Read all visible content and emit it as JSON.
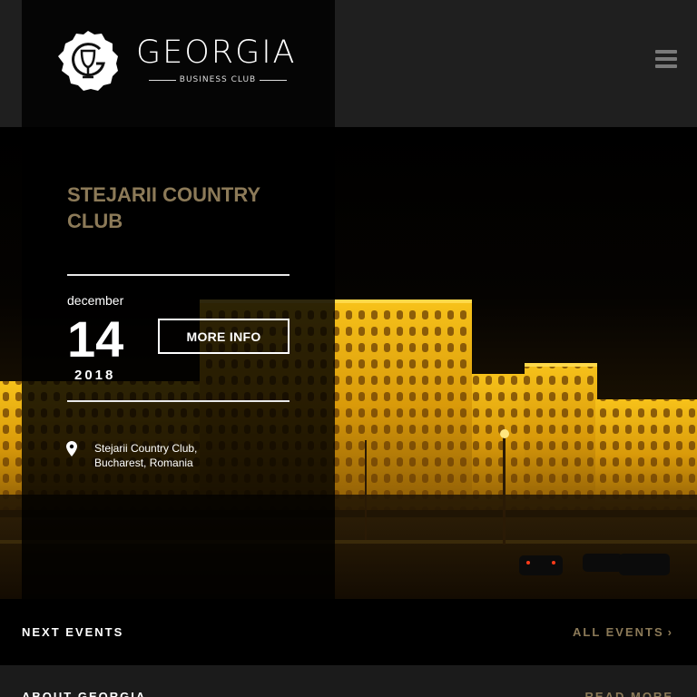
{
  "brand": {
    "name": "GEORGIA",
    "subtitle": "BUSINESS CLUB",
    "logo_icon": "wine-glass-g-logo-icon"
  },
  "header": {
    "menu_icon": "hamburger-menu-icon"
  },
  "featured_event": {
    "title": "STEJARII COUNTRY CLUB",
    "month": "december",
    "day": "14",
    "year": "2018",
    "more_info_label": "MORE INFO",
    "location_icon": "map-pin-icon",
    "address_line1": "Stejarii Country Club,",
    "address_line2": "Bucharest, Romania"
  },
  "next_events": {
    "title": "NEXT EVENTS",
    "link_label": "ALL EVENTS",
    "link_icon": "chevron-right-icon"
  },
  "about": {
    "title": "ABOUT GEORGIA",
    "link_label": "READ MORE"
  },
  "colors": {
    "accent": "#8c7a58",
    "header_bg": "#1f1f1f",
    "panel_bg": "#000000",
    "text": "#ffffff"
  }
}
